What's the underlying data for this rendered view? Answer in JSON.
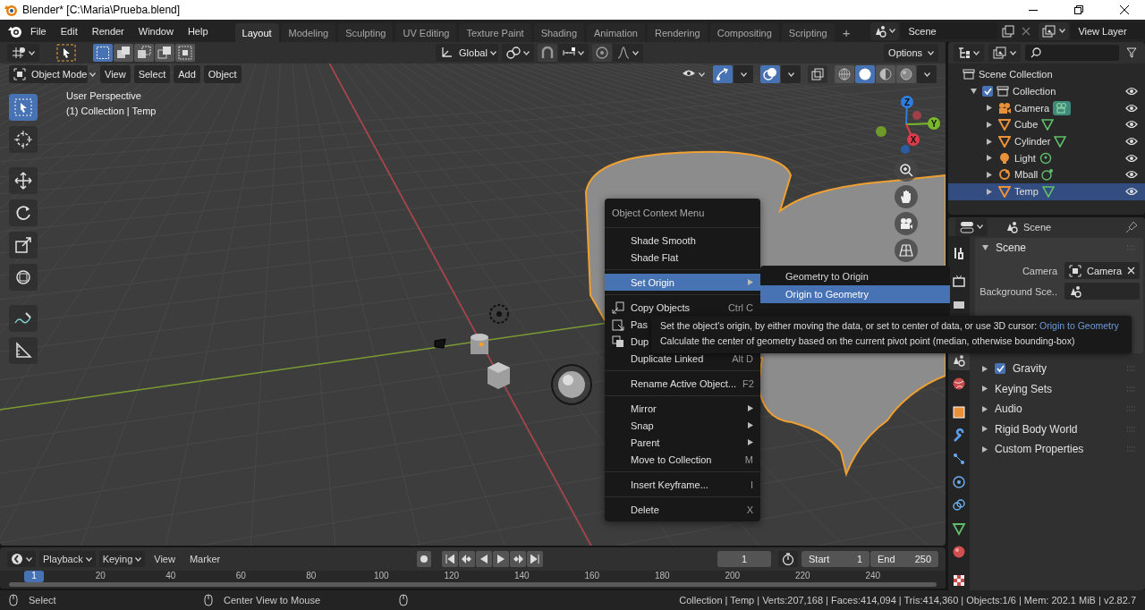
{
  "window": {
    "title": "Blender* [C:\\Maria\\Prueba.blend]"
  },
  "menu": [
    "File",
    "Edit",
    "Render",
    "Window",
    "Help"
  ],
  "workspaces": [
    {
      "label": "Layout",
      "selected": true
    },
    {
      "label": "Modeling",
      "selected": false
    },
    {
      "label": "Sculpting",
      "selected": false
    },
    {
      "label": "UV Editing",
      "selected": false
    },
    {
      "label": "Texture Paint",
      "selected": false
    },
    {
      "label": "Shading",
      "selected": false
    },
    {
      "label": "Animation",
      "selected": false
    },
    {
      "label": "Rendering",
      "selected": false
    },
    {
      "label": "Compositing",
      "selected": false
    },
    {
      "label": "Scripting",
      "selected": false
    }
  ],
  "add_workspace": "+",
  "scene": {
    "value": "Scene"
  },
  "view_layer": {
    "value": "View Layer"
  },
  "tool_header": {
    "select_modes": [
      {
        "kind": "set",
        "selected": true
      },
      {
        "kind": "extend",
        "selected": false
      },
      {
        "kind": "subtract",
        "selected": false
      },
      {
        "kind": "invert",
        "selected": false
      },
      {
        "kind": "intersect",
        "selected": false
      }
    ],
    "orientation": "Global",
    "options": "Options"
  },
  "viewport_header": {
    "mode": "Object Mode",
    "menus": [
      "View",
      "Select",
      "Add",
      "Object"
    ],
    "gizmos_on": true,
    "overlays_on": true,
    "xray_on": false,
    "shading_modes": [
      {
        "kind": "wireframe",
        "selected": false
      },
      {
        "kind": "solid",
        "selected": true
      },
      {
        "kind": "material",
        "selected": false
      },
      {
        "kind": "rendered",
        "selected": false
      }
    ]
  },
  "viewport": {
    "view_name": "User Perspective",
    "info": "(1) Collection | Temp",
    "tools": [
      {
        "kind": "select",
        "selected": true
      },
      {
        "kind": "cursor",
        "selected": false
      },
      {
        "kind": "move",
        "selected": false
      },
      {
        "kind": "rotate",
        "selected": false
      },
      {
        "kind": "scale",
        "selected": false
      },
      {
        "kind": "transform",
        "selected": false
      },
      {
        "kind": "annotate",
        "selected": false
      },
      {
        "kind": "measure",
        "selected": false
      }
    ],
    "gizmo_axes": [
      {
        "label": "Z",
        "color": "#2e7ee0"
      },
      {
        "label": "Y",
        "color": "#7ab929"
      },
      {
        "label": "X",
        "color": "#e03a4c"
      }
    ]
  },
  "outliner": {
    "items": [
      {
        "label": "Scene Collection",
        "kind": "scene_collection",
        "selected": false,
        "children": [
          {
            "label": "Collection",
            "kind": "collection",
            "checked": true,
            "expanded": true,
            "selected": false,
            "children": [
              {
                "label": "Camera",
                "kind": "camera",
                "expanded": false,
                "selected": false
              },
              {
                "label": "Cube",
                "kind": "mesh",
                "expanded": false,
                "selected": false
              },
              {
                "label": "Cylinder",
                "kind": "mesh",
                "expanded": false,
                "selected": false
              },
              {
                "label": "Light",
                "kind": "light",
                "expanded": false,
                "selected": false
              },
              {
                "label": "Mball",
                "kind": "metaball",
                "expanded": false,
                "selected": false
              },
              {
                "label": "Temp",
                "kind": "mesh",
                "expanded": false,
                "selected": true
              }
            ]
          }
        ]
      }
    ]
  },
  "properties": {
    "breadcrumb": "Scene",
    "tab_groups": [
      [
        {
          "kind": "tool",
          "selected": false
        }
      ],
      [
        {
          "kind": "render",
          "selected": false
        },
        {
          "kind": "output",
          "selected": false
        }
      ],
      [
        {
          "kind": "scene",
          "selected": true
        },
        {
          "kind": "world",
          "selected": false
        }
      ],
      [
        {
          "kind": "object",
          "selected": false
        },
        {
          "kind": "modifiers",
          "selected": false
        },
        {
          "kind": "particles",
          "selected": false
        },
        {
          "kind": "physics",
          "selected": false
        },
        {
          "kind": "constraints",
          "selected": false
        },
        {
          "kind": "data",
          "selected": false
        },
        {
          "kind": "material",
          "selected": false
        }
      ],
      [
        {
          "kind": "texture",
          "selected": false
        }
      ]
    ],
    "section": {
      "title": "Scene",
      "expanded": true
    },
    "fields": [
      {
        "label": "Camera",
        "value": "Camera",
        "kind": "object"
      },
      {
        "label": "Background Sce..",
        "kind": "scene"
      }
    ],
    "panels": [
      {
        "label": "Gravity",
        "kind": "checkbox",
        "checked": true,
        "expanded": false
      },
      {
        "label": "Keying Sets",
        "kind": "plain",
        "expanded": false
      },
      {
        "label": "Audio",
        "kind": "plain",
        "expanded": false
      },
      {
        "label": "Rigid Body World",
        "kind": "plain",
        "expanded": false
      },
      {
        "label": "Custom Properties",
        "kind": "plain",
        "expanded": false
      }
    ]
  },
  "context_menu": {
    "title": "Object Context Menu",
    "groups": [
      [
        {
          "label": "Shade Smooth",
          "kind": "plain",
          "selected": false
        },
        {
          "label": "Shade Flat",
          "kind": "plain",
          "selected": false
        }
      ],
      [
        {
          "label": "Set Origin",
          "kind": "plain",
          "submenu": true,
          "selected": true
        }
      ],
      [
        {
          "label": "Copy Objects",
          "kind": "copy",
          "shortcut": "Ctrl C",
          "selected": false
        },
        {
          "label": "Pas",
          "kind": "paste",
          "selected": false
        },
        {
          "label": "Dup",
          "kind": "duplicate",
          "selected": false
        },
        {
          "label": "Duplicate Linked",
          "kind": "plain",
          "shortcut": "Alt D",
          "selected": false
        }
      ],
      [
        {
          "label": "Rename Active Object...",
          "kind": "plain",
          "shortcut": "F2",
          "selected": false
        }
      ],
      [
        {
          "label": "Mirror",
          "kind": "plain",
          "submenu": true,
          "selected": false
        },
        {
          "label": "Snap",
          "kind": "plain",
          "submenu": true,
          "selected": false
        },
        {
          "label": "Parent",
          "kind": "plain",
          "submenu": true,
          "selected": false
        },
        {
          "label": "Move to Collection",
          "kind": "plain",
          "shortcut": "M",
          "selected": false
        }
      ],
      [
        {
          "label": "Insert Keyframe...",
          "kind": "plain",
          "shortcut": "I",
          "selected": false
        }
      ],
      [
        {
          "label": "Delete",
          "kind": "plain",
          "shortcut": "X",
          "selected": false
        }
      ]
    ]
  },
  "submenu": {
    "items": [
      {
        "label": "Geometry to Origin",
        "selected": false
      },
      {
        "label": "Origin to Geometry",
        "selected": true
      }
    ]
  },
  "tooltip": {
    "text": "Set the object's origin, by either moving the data, or set to center of data, or use 3D cursor:",
    "hint": "Origin to Geometry",
    "description": "Calculate the center of geometry based on the current pivot point (median, otherwise bounding-box)"
  },
  "timeline": {
    "menus": [
      {
        "label": "Playback",
        "dropdown": true
      },
      {
        "label": "Keying",
        "dropdown": true
      },
      {
        "label": "View",
        "dropdown": false
      },
      {
        "label": "Marker",
        "dropdown": false
      }
    ],
    "current_frame": "1",
    "start_label": "Start",
    "start": "1",
    "end_label": "End",
    "end": "250",
    "ruler_current": "1",
    "ruler_ticks": [
      "20",
      "40",
      "60",
      "80",
      "100",
      "120",
      "140",
      "160",
      "180",
      "200",
      "220",
      "240"
    ]
  },
  "status_bar": {
    "hints": [
      "Select",
      "Center View to Mouse"
    ],
    "stats": "Collection | Temp | Verts:207,168 | Faces:414,094 | Tris:414,360 | Objects:1/6 | Mem: 202.1 MiB | v2.82.7"
  }
}
